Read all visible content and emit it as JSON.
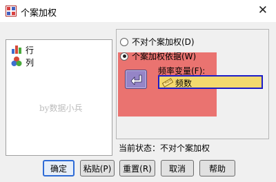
{
  "window": {
    "title": "个案加权",
    "close_glyph": "✕"
  },
  "variables": [
    {
      "label": "行",
      "icon": "nominal-bar-icon"
    },
    {
      "label": "列",
      "icon": "nominal-balls-icon"
    }
  ],
  "watermark": "by数据小兵",
  "options": {
    "no_weight": "不对个案加权(D)",
    "weight_by": "个案加权依据(W)",
    "selected": "weight_by"
  },
  "frequency": {
    "label": "频率变量(F):",
    "value": "频数",
    "icon": "scale-ruler-icon"
  },
  "status": "当前状态：不对个案加权",
  "buttons": {
    "ok": "确定",
    "paste": "粘贴(P)",
    "reset": "重置(R)",
    "cancel": "取消",
    "help": "帮助"
  },
  "colors": {
    "highlight": "#e8504b",
    "move_button": "#9585c7",
    "field_fill": "#f3d96e",
    "field_border": "#1b1bc8"
  }
}
